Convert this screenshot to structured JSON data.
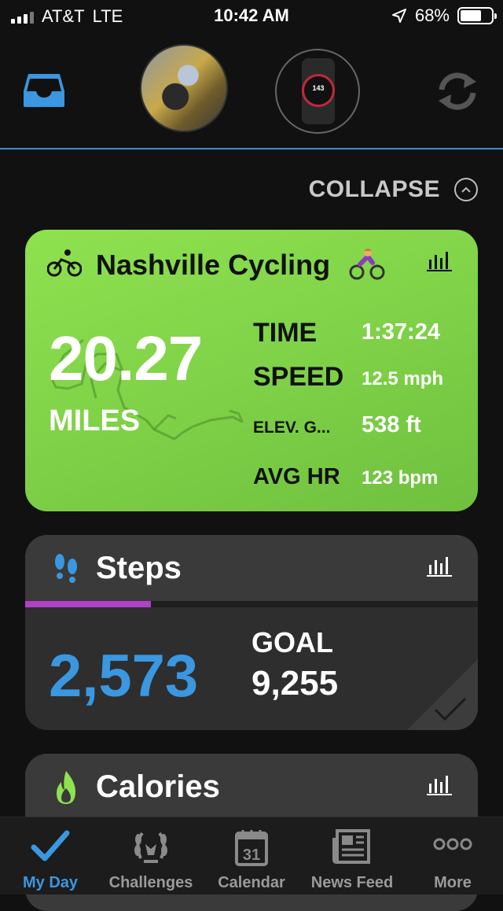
{
  "status_bar": {
    "carrier": "AT&T",
    "network": "LTE",
    "time": "10:42 AM",
    "battery_percent": "68%",
    "battery_level": 0.68
  },
  "header": {
    "watch_face_value": "143"
  },
  "collapse": {
    "label": "COLLAPSE"
  },
  "cycling_card": {
    "title": "Nashville Cycling",
    "distance": "20.27",
    "distance_unit": "MILES",
    "stats": [
      {
        "label": "TIME",
        "value": "1:37:24"
      },
      {
        "label": "SPEED",
        "value": "12.5 mph"
      },
      {
        "label": "ELEV. G...",
        "value": "538 ft"
      },
      {
        "label": "AVG HR",
        "value": "123 bpm"
      }
    ],
    "color": "#86d94a"
  },
  "steps_card": {
    "title": "Steps",
    "count": "2,573",
    "goal_label": "GOAL",
    "goal_value": "9,255",
    "progress": 0.278,
    "progress_color": "#b040c8",
    "count_color": "#3a97e0"
  },
  "calories_card": {
    "title": "Calories"
  },
  "tab_bar": {
    "tabs": [
      {
        "label": "My Day",
        "icon": "check-icon",
        "active": true
      },
      {
        "label": "Challenges",
        "icon": "laurel-icon",
        "active": false
      },
      {
        "label": "Calendar",
        "icon": "calendar-icon",
        "active": false,
        "icon_text": "31"
      },
      {
        "label": "News Feed",
        "icon": "newspaper-icon",
        "active": false
      },
      {
        "label": "More",
        "icon": "more-icon",
        "active": false
      }
    ],
    "accent": "#3a97e0"
  }
}
